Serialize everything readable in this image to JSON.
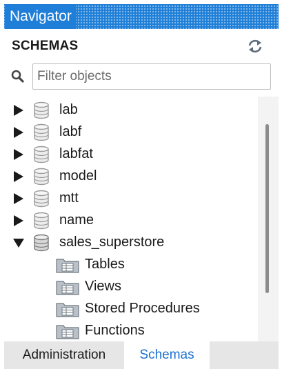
{
  "navigator": {
    "title": "Navigator"
  },
  "schemas_panel": {
    "header": "SCHEMAS",
    "filter_placeholder": "Filter objects",
    "schemas": [
      {
        "name": "lab",
        "expanded": false
      },
      {
        "name": "labf",
        "expanded": false
      },
      {
        "name": "labfat",
        "expanded": false
      },
      {
        "name": "model",
        "expanded": false
      },
      {
        "name": "mtt",
        "expanded": false
      },
      {
        "name": "name",
        "expanded": false
      },
      {
        "name": "sales_superstore",
        "expanded": true,
        "children": [
          "Tables",
          "Views",
          "Stored Procedures",
          "Functions"
        ]
      }
    ]
  },
  "tabs": {
    "administration": "Administration",
    "schemas": "Schemas",
    "active": "Schemas"
  },
  "colors": {
    "titlebar": "#1f7fd8",
    "active_tab_text": "#1a6fd0",
    "tabbar_bg": "#e6e6e6"
  },
  "icons": {
    "refresh": "refresh-icon",
    "search": "search-icon",
    "schema": "database-icon",
    "folder": "folder-icon",
    "collapsed": "expand-arrow-icon",
    "expanded": "collapse-arrow-icon"
  }
}
